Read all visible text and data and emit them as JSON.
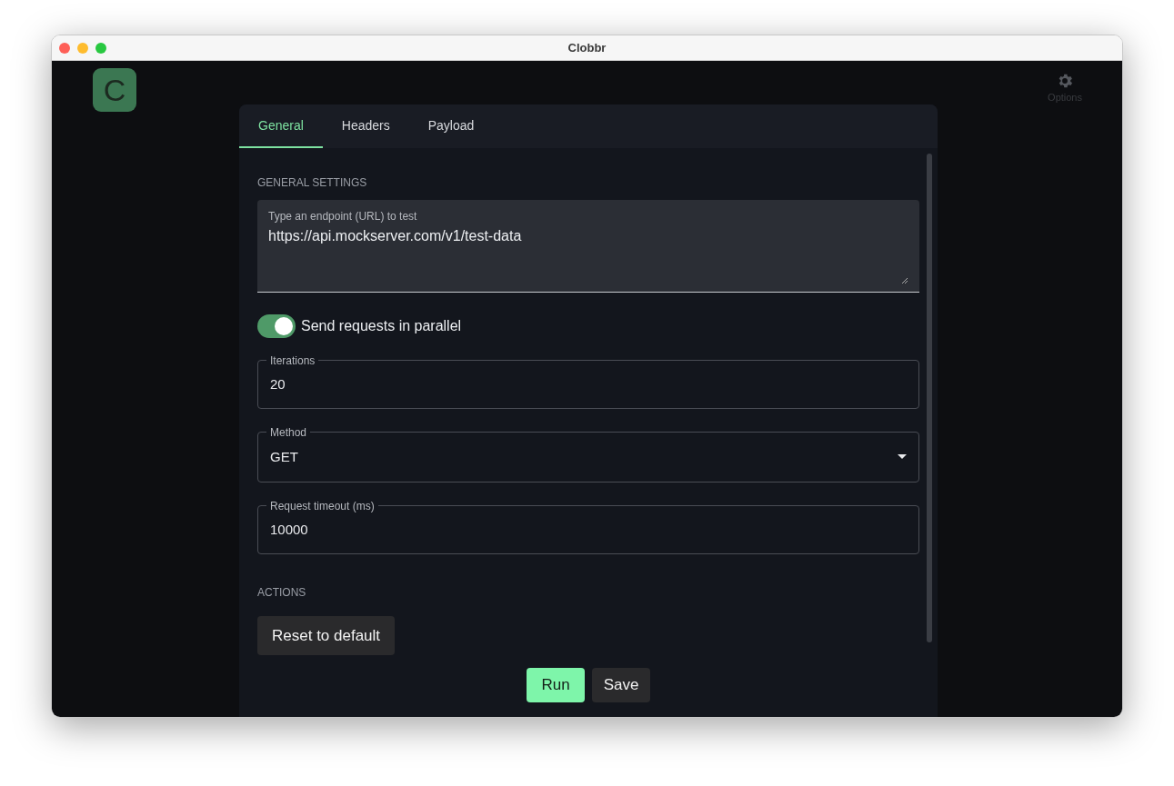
{
  "window": {
    "title": "Clobbr"
  },
  "logo": {
    "letter": "C"
  },
  "options_button": {
    "label": "Options"
  },
  "tabs": [
    {
      "label": "General",
      "selected": true
    },
    {
      "label": "Headers",
      "selected": false
    },
    {
      "label": "Payload",
      "selected": false
    }
  ],
  "general_settings": {
    "heading": "GENERAL SETTINGS",
    "endpoint": {
      "label": "Type an endpoint (URL) to test",
      "value": "https://api.mockserver.com/v1/test-data"
    },
    "parallel_toggle": {
      "label": "Send requests in parallel",
      "on": true
    },
    "fields": [
      {
        "kind": "text",
        "label": "Iterations",
        "value": "20"
      },
      {
        "kind": "select",
        "label": "Method",
        "value": "GET"
      },
      {
        "kind": "text",
        "label": "Request timeout (ms)",
        "value": "10000"
      }
    ]
  },
  "actions": {
    "heading": "ACTIONS",
    "buttons": [
      {
        "label": "Reset to default"
      }
    ]
  },
  "footer_buttons": [
    {
      "label": "Run",
      "kind": "primary"
    },
    {
      "label": "Save",
      "kind": "secondary"
    }
  ]
}
